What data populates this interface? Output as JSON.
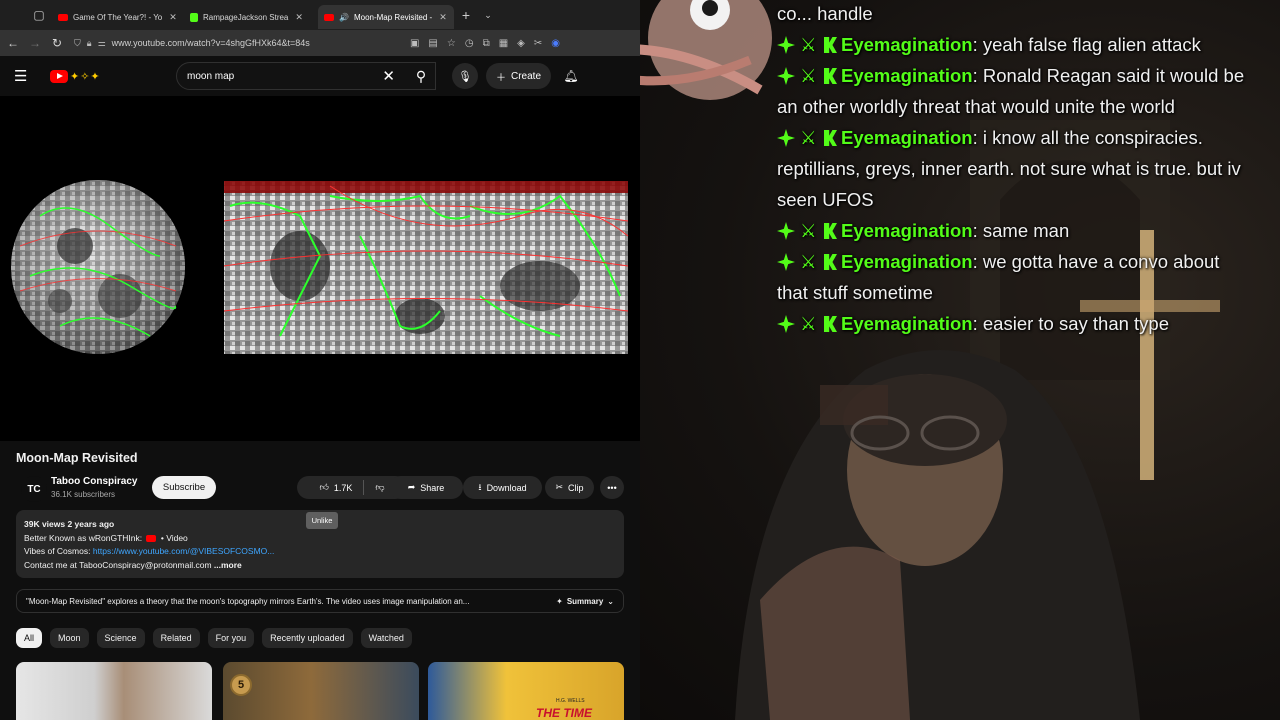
{
  "browser": {
    "tabs": [
      {
        "title": "Game Of The Year?! - Yo",
        "favicon": "youtube-icon",
        "active": false
      },
      {
        "title": "RampageJackson Strea",
        "favicon": "kick-icon",
        "active": false
      },
      {
        "title": "Moon-Map Revisited -",
        "favicon": "youtube-icon",
        "active": true
      }
    ],
    "new_tab": "+",
    "url": "www.youtube.com/watch?v=4shgGfHXk64&t=84s"
  },
  "youtube": {
    "search_value": "moon map",
    "create_label": "Create",
    "video": {
      "title": "Moon-Map Revisited",
      "channel_avatar": "TC",
      "channel_name": "Taboo Conspiracy",
      "subscribers": "36.1K subscribers",
      "subscribe_label": "Subscribe",
      "likes": "1.7K",
      "share_label": "Share",
      "download_label": "Download",
      "clip_label": "Clip",
      "tooltip": "Unlike",
      "description": {
        "meta": "39K views  2 years ago",
        "line1_prefix": "Better Known as wRonGTHInk:",
        "line1_suffix": "• Video",
        "line2_prefix": "Vibes of Cosmos:",
        "line2_link": "https://www.youtube.com/@VIBESOFCOSMO...",
        "line3": "Contact me at TabooConspiracy@protonmail.com",
        "more": "...more"
      },
      "ai_summary": "\"Moon-Map Revisited\" explores a theory that the moon's topography mirrors Earth's. The video uses image manipulation an...",
      "summary_label": "Summary"
    },
    "chips": [
      "All",
      "Moon",
      "Science",
      "Related",
      "For you",
      "Recently uploaded",
      "Watched"
    ],
    "recs": {
      "thumb2_badge": "5",
      "thumb3_title": "THE TIME",
      "thumb3_author": "H.G. WELLS"
    }
  },
  "chat": {
    "username": "Eyemagination",
    "partial_first": "co... handle",
    "messages": [
      {
        "text": "yeah false flag alien attack",
        "cont": ""
      },
      {
        "text": "Ronald Reagan said it would be",
        "cont": "an other worldly threat that would unite the world"
      },
      {
        "text": "i know all the conspiracies.",
        "cont": "reptillians, greys, inner earth. not sure what is true. but iv"
      },
      {
        "text": "",
        "cont": "seen UFOS"
      },
      {
        "text": "same man",
        "cont": ""
      },
      {
        "text": "we gotta have a convo about",
        "cont": "that stuff sometime"
      },
      {
        "text": "easier to say than type",
        "cont": ""
      }
    ]
  }
}
